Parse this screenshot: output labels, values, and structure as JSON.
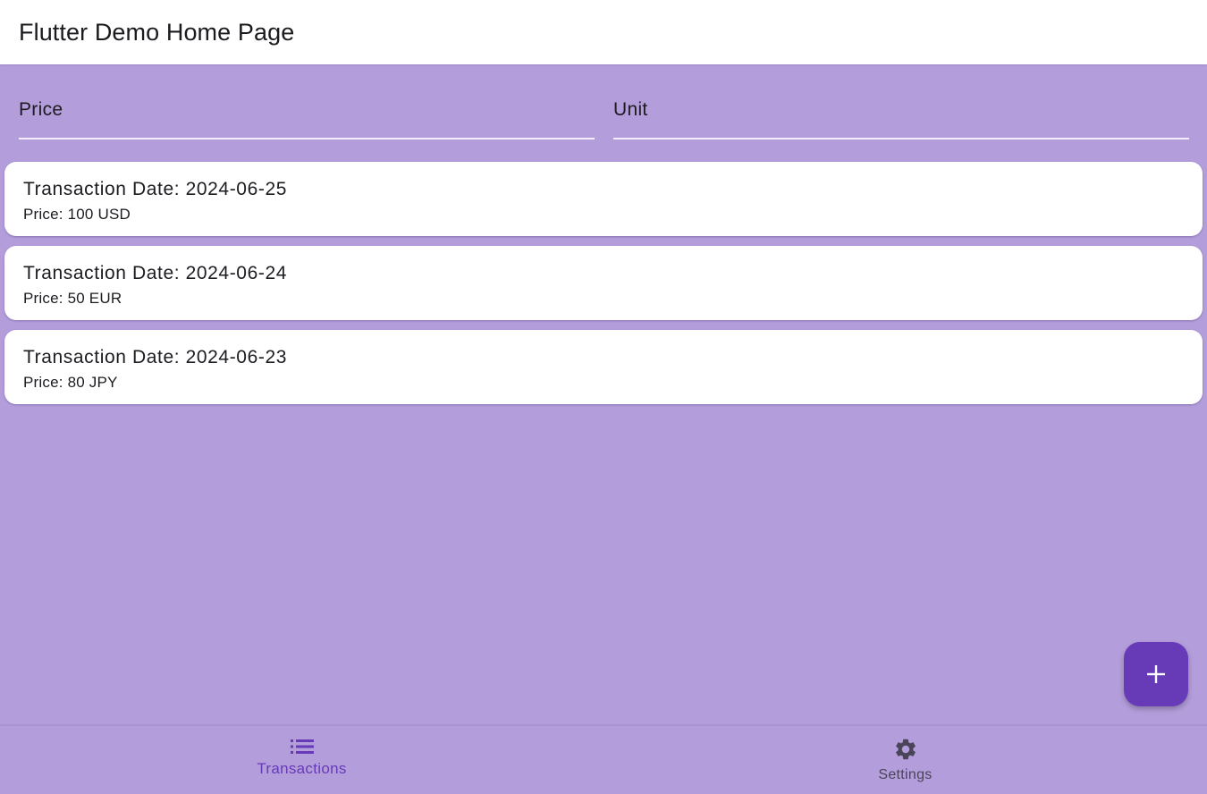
{
  "app_bar": {
    "title": "Flutter Demo Home Page"
  },
  "filters": {
    "price_placeholder": "Price",
    "unit_placeholder": "Unit"
  },
  "transactions": [
    {
      "date_label": "Transaction Date: 2024-06-25",
      "price_label": "Price: 100 USD"
    },
    {
      "date_label": "Transaction Date: 2024-06-24",
      "price_label": "Price: 50 EUR"
    },
    {
      "date_label": "Transaction Date: 2024-06-23",
      "price_label": "Price: 80 JPY"
    }
  ],
  "fab": {
    "icon": "plus-icon"
  },
  "bottom_nav": {
    "items": [
      {
        "label": "Transactions",
        "icon": "list-icon",
        "active": true
      },
      {
        "label": "Settings",
        "icon": "gear-icon",
        "active": false
      }
    ]
  },
  "colors": {
    "background": "#b39ddb",
    "primary": "#673ab7",
    "surface": "#ffffff",
    "inactive_nav": "#4a4458"
  }
}
